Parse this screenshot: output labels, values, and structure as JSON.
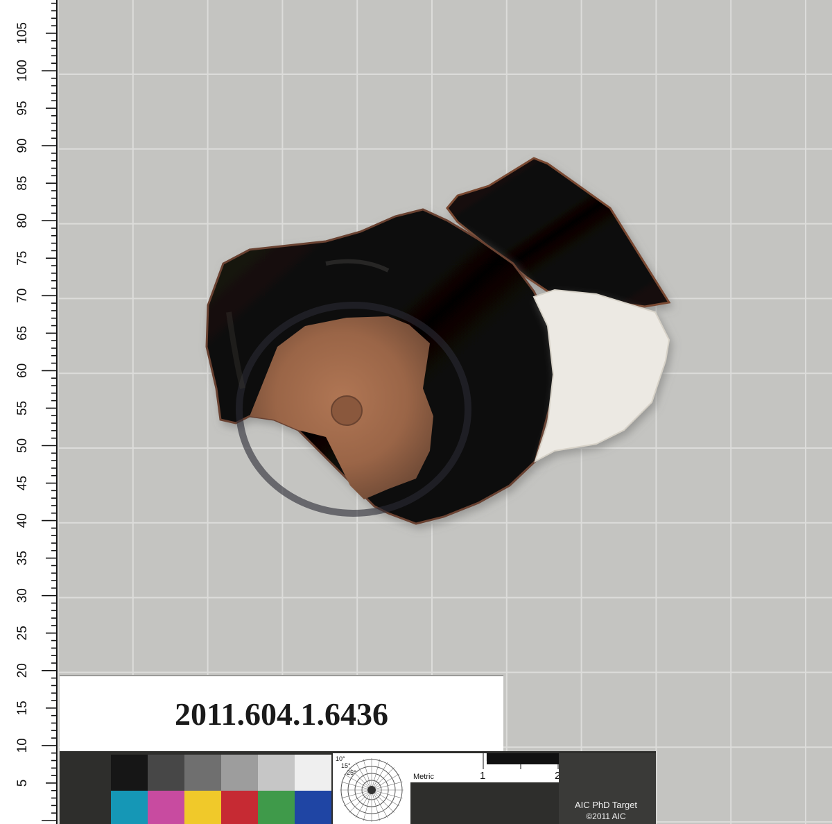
{
  "object": {
    "accession_number": "2011.604.1.6436",
    "description": "Terracotta fragment with black glaze, reserved clay floor with central stamp, and white plaster fill"
  },
  "ruler": {
    "unit_labels": [
      "5",
      "10",
      "15",
      "20",
      "25",
      "30",
      "35",
      "40",
      "45",
      "50",
      "55",
      "60",
      "65",
      "70",
      "75",
      "80",
      "85",
      "90",
      "95",
      "100",
      "105"
    ]
  },
  "target": {
    "metric_label": "Metric",
    "scale_marks": [
      "1",
      "2"
    ],
    "angles": [
      "10°",
      "15°",
      "25°"
    ],
    "name": "AIC PhD Target",
    "copyright": "©2011 AIC"
  },
  "colors": {
    "background": "#c4c4c1",
    "grid_line": "#dcdcda",
    "glaze": "#0b0908",
    "clay": "#9a6547",
    "plaster": "#ece9e3",
    "swatches_top": [
      "#161616",
      "#474747",
      "#6f6f6f",
      "#9d9d9d",
      "#c6c6c6",
      "#efefef"
    ],
    "swatches_bottom": [
      "#1597b6",
      "#c84ba0",
      "#f0c92a",
      "#c62a33",
      "#3f9a4a",
      "#1f45a4"
    ]
  }
}
